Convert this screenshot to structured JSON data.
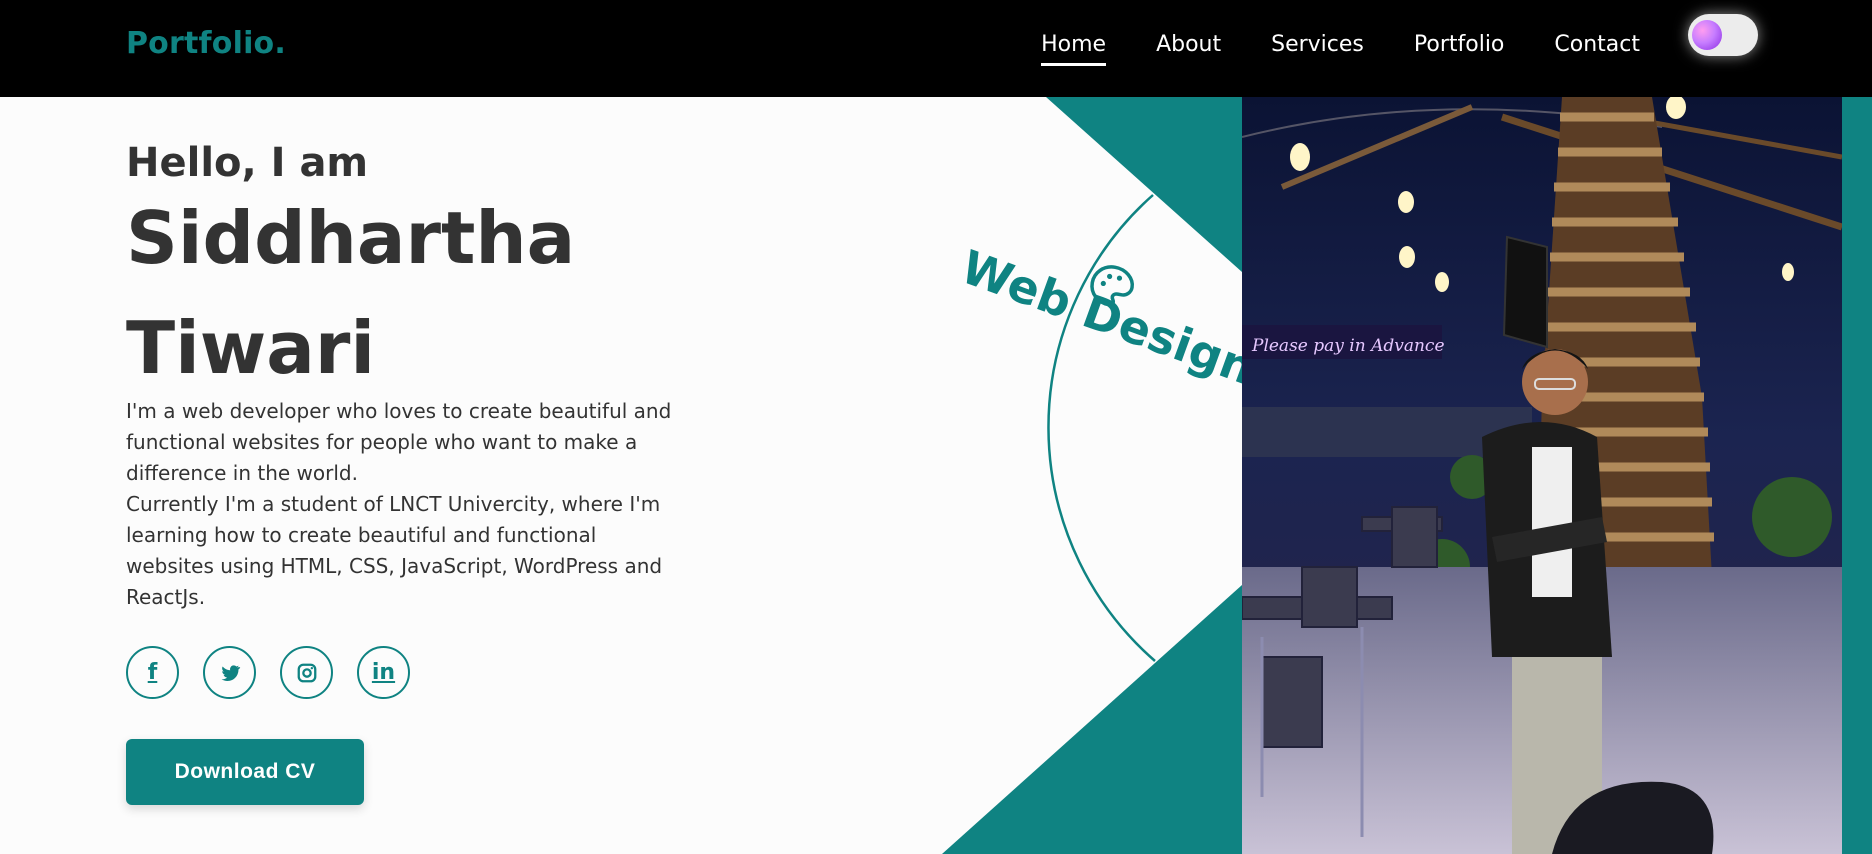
{
  "header": {
    "logo": "Portfolio.",
    "nav": [
      {
        "label": "Home",
        "active": true
      },
      {
        "label": "About",
        "active": false
      },
      {
        "label": "Services",
        "active": false
      },
      {
        "label": "Portfolio",
        "active": false
      },
      {
        "label": "Contact",
        "active": false
      }
    ]
  },
  "hero": {
    "greeting": "Hello, I am",
    "name_line1": "Siddhartha",
    "name_line2": "Tiwari",
    "bio_lines": [
      "I'm a web developer who loves to create beautiful and",
      "functional websites for people who want to make a",
      "difference in the world.",
      "Currently I'm a student of LNCT Univercity, where I'm",
      "learning how to create beautiful and functional",
      "websites using HTML, CSS, JavaScript, WordPress and",
      "ReactJs."
    ],
    "socials": [
      {
        "name": "facebook-icon",
        "glyph": "f"
      },
      {
        "name": "twitter-icon",
        "glyph": ""
      },
      {
        "name": "instagram-icon",
        "glyph": ""
      },
      {
        "name": "linkedin-icon",
        "glyph": "in"
      }
    ],
    "cta": "Download CV",
    "badge": "Web Designer"
  },
  "photo": {
    "sign_text": "Please pay in Advance"
  },
  "colors": {
    "accent": "#0f8382",
    "header_bg": "#000000",
    "page_bg": "#fcfcfc",
    "text": "#333333"
  }
}
